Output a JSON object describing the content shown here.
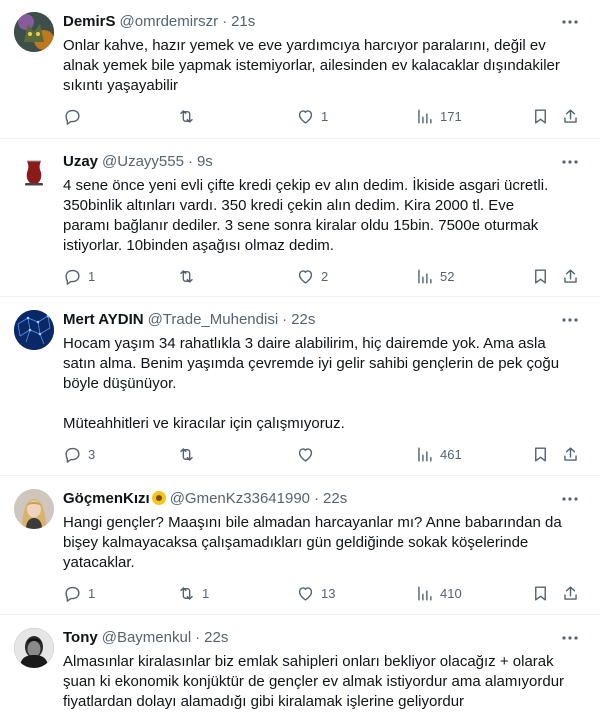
{
  "tweets": [
    {
      "name": "DemirS",
      "handle": "@omrdemirszr",
      "time": "21s",
      "text": "Onlar kahve, hazır yemek ve eve yardımcıya harcıyor paralarını, değil ev\nalnak yemek bile yapmak istemiyorlar, ailesinden ev kalacaklar dışındakiler\nsıkıntı yaşayabilir",
      "replies": "",
      "retweets": "",
      "likes": "1",
      "views": "171",
      "avatar_icon": "cat-avatar"
    },
    {
      "name": "Uzay",
      "handle": "@Uzayy555",
      "time": "9s",
      "text": "4 sene önce yeni evli çifte kredi çekip ev alın dedim. İkiside asgari ücretli.\n350binlik altınları vardı. 350 kredi çekin alın dedim. Kira 2000 tl. Eve\nparamı bağlanır dediler. 3 sene sonra kiralar oldu 15bin. 7500e oturmak\nistiyorlar. 10binden aşağısı olmaz dedim.",
      "replies": "1",
      "retweets": "",
      "likes": "2",
      "views": "52",
      "avatar_icon": "tea-glass-avatar"
    },
    {
      "name": "Mert AYDIN",
      "handle": "@Trade_Muhendisi",
      "time": "22s",
      "text": "Hocam yaşım 34 rahatlıkla 3 daire alabilirim, hiç dairemde yok. Ama asla\nsatın alma. Benim yaşımda çevremde iyi gelir sahibi gençlerin de pek çoğu\nböyle düşünüyor.\n\nMüteahhitleri ve kiracılar için çalışmıyoruz.",
      "replies": "3",
      "retweets": "",
      "likes": "",
      "views": "461",
      "avatar_icon": "network-avatar"
    },
    {
      "name": "GöçmenKızı",
      "handle": "@GmenKz33641990",
      "time": "22s",
      "text": "Hangi gençler? Maaşını bile almadan harcayanlar mı? Anne babarından da\nbişey kalmayacaksa çalışamadıkları gün geldiğinde sokak köşelerinde\nyatacaklar.",
      "replies": "1",
      "retweets": "1",
      "likes": "13",
      "views": "410",
      "avatar_icon": "woman-avatar",
      "name_emoji": "sunflower-icon"
    },
    {
      "name": "Tony",
      "handle": "@Baymenkul",
      "time": "22s",
      "text": "Almasınlar kiralasınlar biz emlak sahipleri onları bekliyor olacağız + olarak\nşuan ki ekonomik konjüktür de gençler ev almak istiyordur ama alamıyordur\nfiyatlardan dolayı alamadığı gibi kiralamak işlerine geliyordur",
      "replies": "",
      "retweets": "",
      "likes": "",
      "views": "",
      "avatar_icon": "man-avatar"
    }
  ],
  "colors": {
    "text": "#0f1419",
    "muted": "#536471",
    "divider": "#eff3f4"
  }
}
